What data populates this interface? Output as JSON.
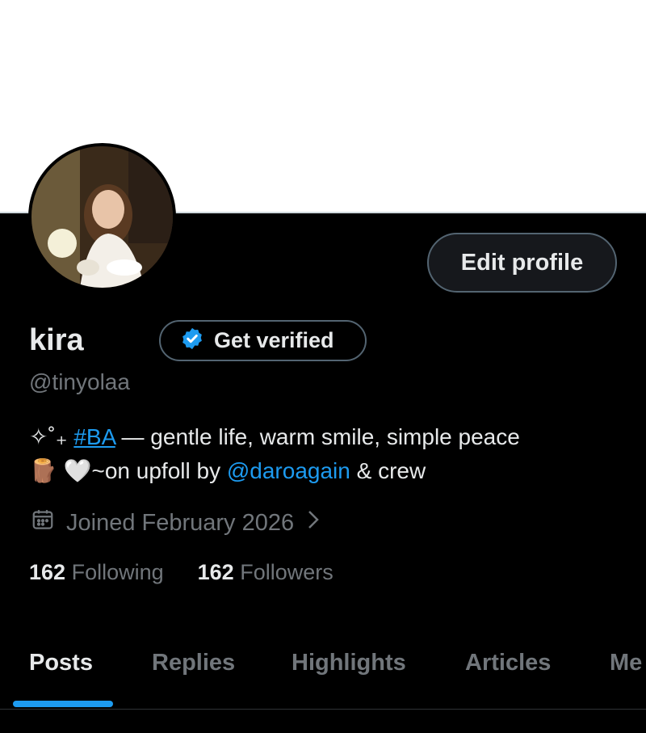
{
  "profile": {
    "name": "kira",
    "handle": "@tinyolaa",
    "edit_label": "Edit profile",
    "verify_label": "Get verified",
    "bio": {
      "line1_prefix": "✧˚₊ ",
      "hashtag": "#BA",
      "line1_suffix": " — gentle life, warm smile, simple peace",
      "line2_prefix": "🪵 🤍~on upfoll by ",
      "mention": "@daroagain",
      "line2_suffix": " & crew"
    },
    "joined": "Joined February 2026",
    "following_count": "162",
    "following_label": "Following",
    "followers_count": "162",
    "followers_label": "Followers"
  },
  "tabs": [
    {
      "label": "Posts",
      "active": true
    },
    {
      "label": "Replies"
    },
    {
      "label": "Highlights"
    },
    {
      "label": "Articles"
    },
    {
      "label": "Me"
    }
  ],
  "colors": {
    "accent": "#1d9bf0",
    "muted": "#71767b",
    "background": "#000000",
    "text": "#e7e9ea"
  }
}
